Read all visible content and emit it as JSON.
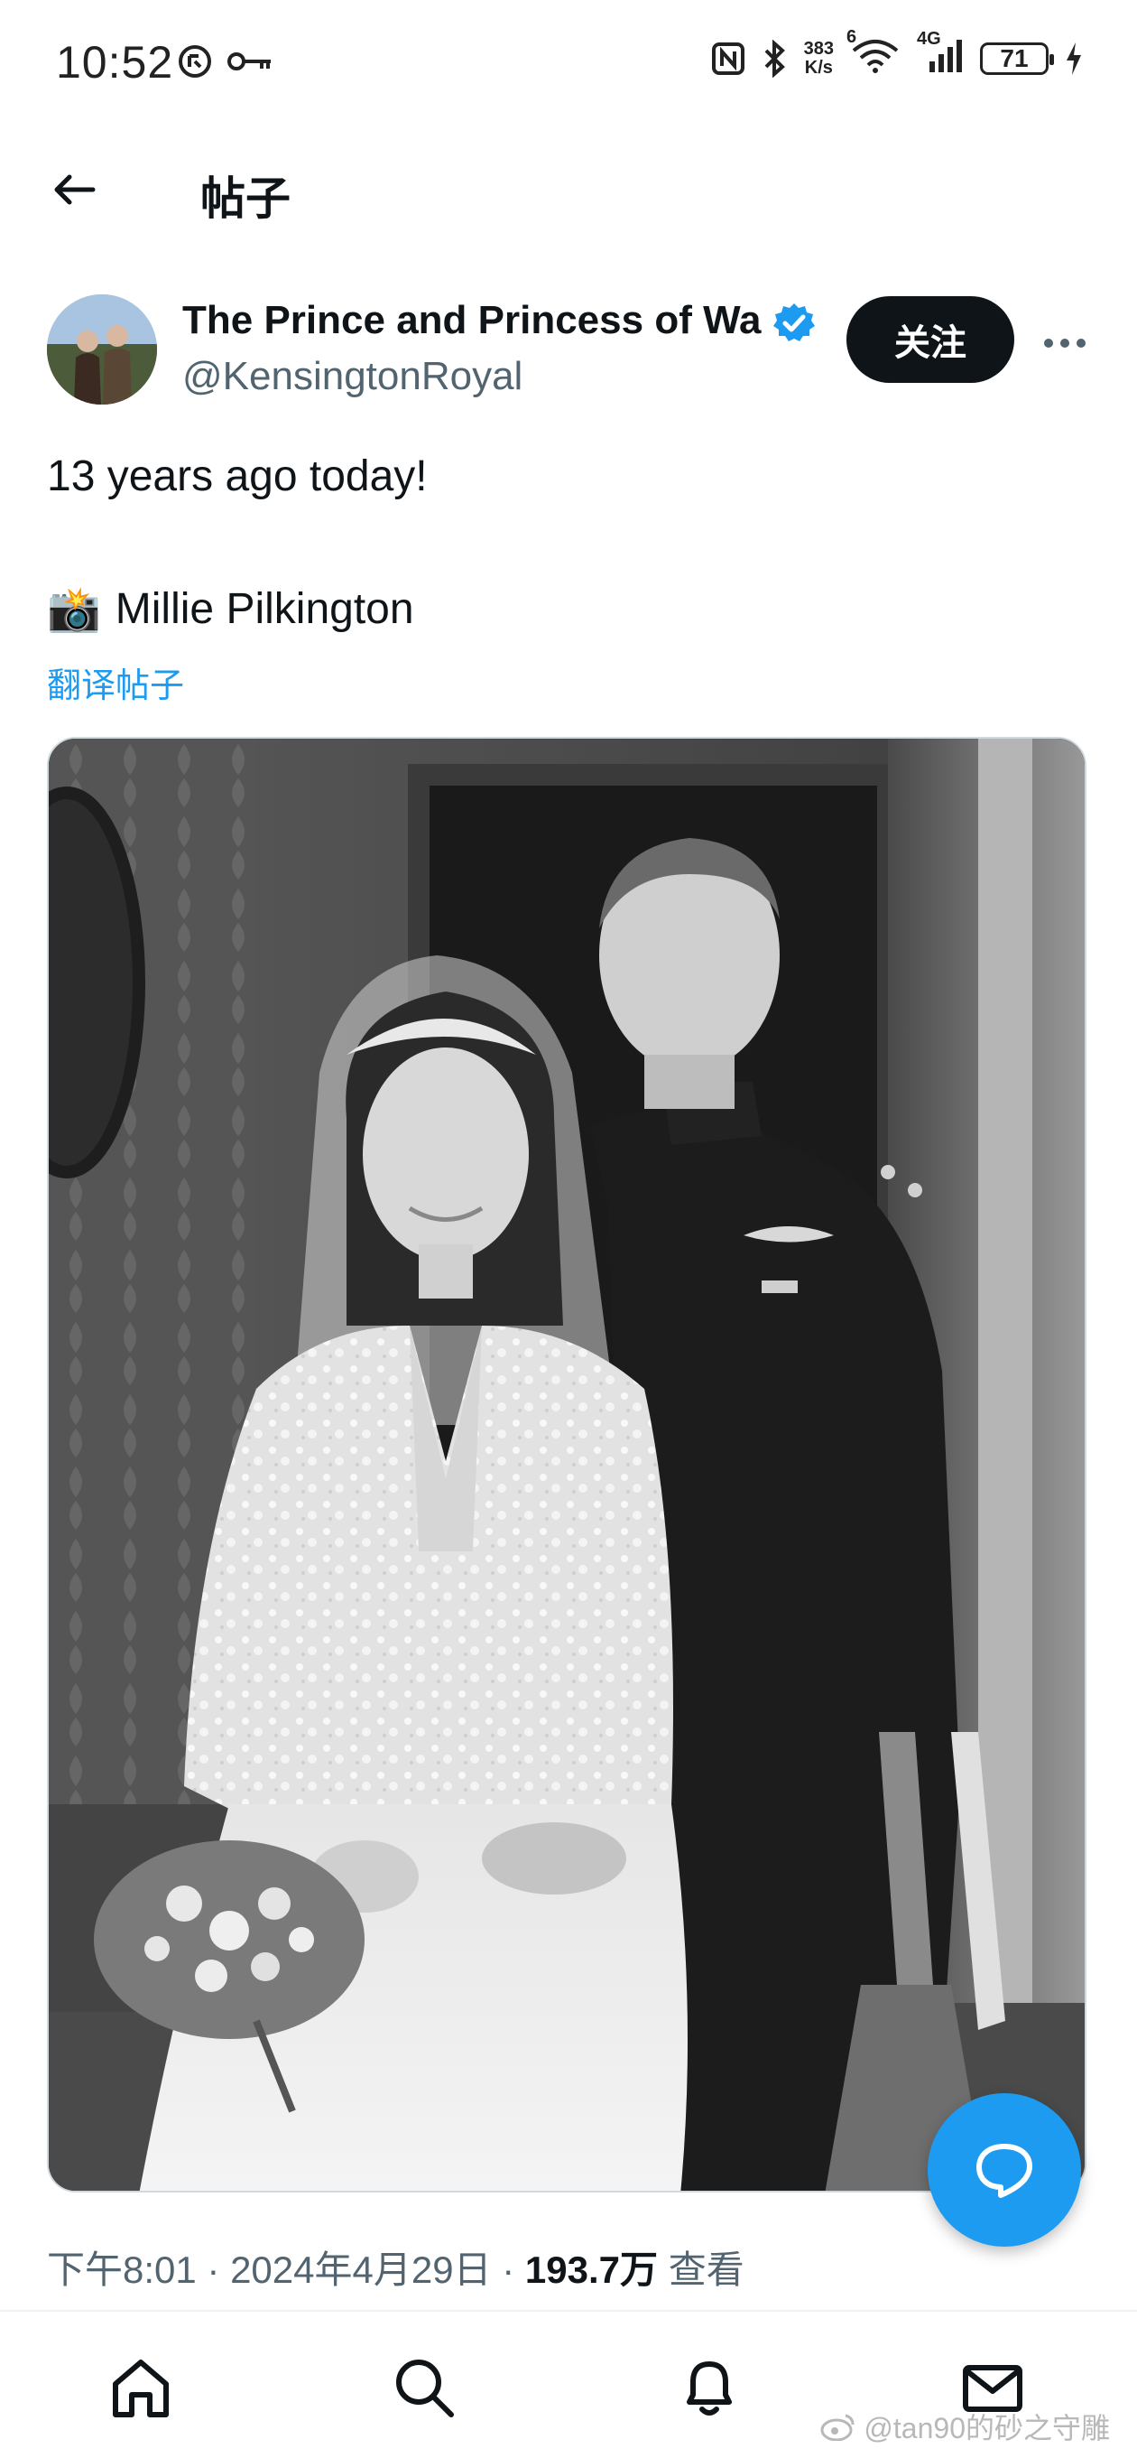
{
  "status_bar": {
    "time": "10:52",
    "speed_top": "383",
    "speed_bottom": "K/s",
    "wifi_label": "6",
    "network_label": "4G",
    "battery": "71"
  },
  "header": {
    "title": "帖子"
  },
  "post": {
    "display_name": "The Prince and Princess of Wa",
    "handle": "@KensingtonRoyal",
    "follow_label": "关注",
    "text": "13 years ago today!",
    "credit_emoji": "📸",
    "credit_name": "Millie Pilkington",
    "translate_label": "翻译帖子",
    "time": "下午8:01",
    "date": "2024年4月29日",
    "views_count": "193.7万",
    "views_label": "查看"
  },
  "watermark": "@tan90的砂之守雕",
  "colors": {
    "accent": "#1d9bf0",
    "text_primary": "#0f1419",
    "text_secondary": "#536471"
  },
  "icons": {
    "back": "arrow-left-icon",
    "verified": "verified-badge-icon",
    "more": "more-horizontal-icon",
    "fab": "reply-bubble-icon",
    "home": "home-icon",
    "search": "search-icon",
    "notifications": "bell-icon",
    "messages": "mail-icon"
  }
}
